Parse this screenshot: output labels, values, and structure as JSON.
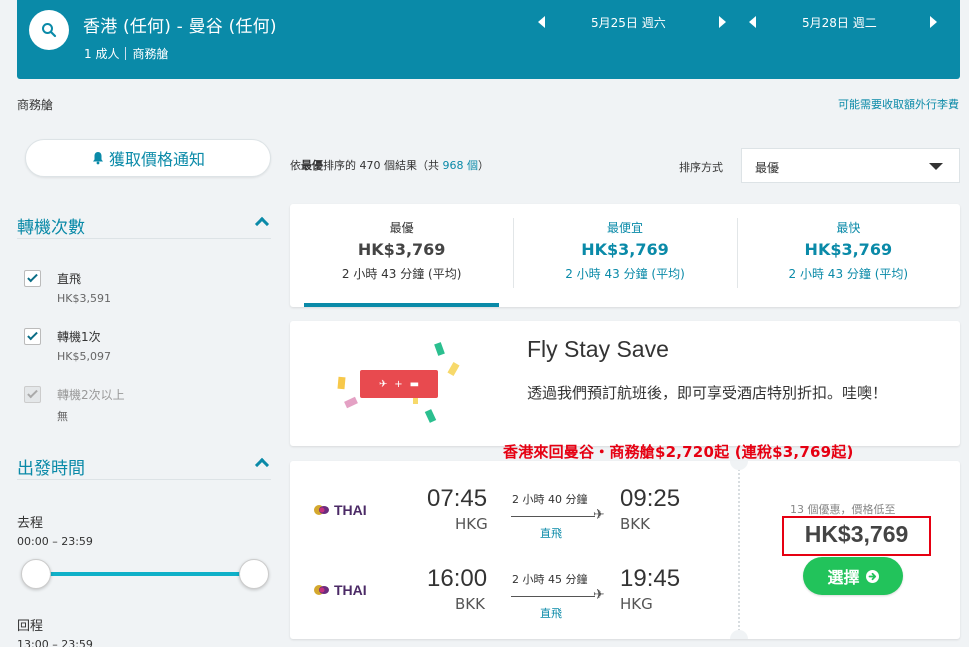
{
  "header": {
    "route": "香港 (任何) - 曼谷 (任何)",
    "passengers": "1 成人",
    "cabin": "商務艙",
    "depart_date": "5月25日 週六",
    "return_date": "5月28日 週二"
  },
  "cabin_label": "商務艙",
  "baggage_link": "可能需要收取額外行李費",
  "sidebar": {
    "alert_button": "獲取價格通知",
    "stops_title": "轉機次數",
    "stops": [
      {
        "label": "直飛",
        "price": "HK$3,591",
        "checked": true,
        "disabled": false
      },
      {
        "label": "轉機1次",
        "price": "HK$5,097",
        "checked": true,
        "disabled": false
      },
      {
        "label": "轉機2次以上",
        "price": "無",
        "checked": true,
        "disabled": true
      }
    ],
    "time_title": "出發時間",
    "outbound_label": "去程",
    "outbound_range": "00:00 – 23:59",
    "return_label": "回程",
    "return_range": "13:00 – 23:59"
  },
  "results": {
    "prefix": "依",
    "sort_word": "最優",
    "middle": "排序的 470 個結果（共 ",
    "total": "968 個",
    "suffix": "）",
    "sort_label": "排序方式",
    "sort_value": "最優"
  },
  "tabs": [
    {
      "name": "最優",
      "price": "HK$3,769",
      "duration": "2 小時 43 分鐘 (平均)"
    },
    {
      "name": "最便宜",
      "price": "HK$3,769",
      "duration": "2 小時 43 分鐘 (平均)"
    },
    {
      "name": "最快",
      "price": "HK$3,769",
      "duration": "2 小時 43 分鐘 (平均)"
    }
  ],
  "promo": {
    "title": "Fly Stay Save",
    "description": "透過我們預訂航班後，即可享受酒店特別折扣。哇噢！"
  },
  "annotation": "香港來回曼谷・商務艙$2,720起 (連稅$3,769起)",
  "flight": {
    "airline": "THAI",
    "legs": [
      {
        "dep_time": "07:45",
        "dep_code": "HKG",
        "duration": "2 小時 40 分鐘",
        "stops": "直飛",
        "arr_time": "09:25",
        "arr_code": "BKK"
      },
      {
        "dep_time": "16:00",
        "dep_code": "BKK",
        "duration": "2 小時 45 分鐘",
        "stops": "直飛",
        "arr_time": "19:45",
        "arr_code": "HKG"
      }
    ],
    "deals": "13 個優惠，價格低至",
    "price": "HK$3,769",
    "select_label": "選擇"
  },
  "colors": {
    "brand": "#0a8aa8",
    "cta": "#22c35b",
    "annotation": "#e60012"
  }
}
